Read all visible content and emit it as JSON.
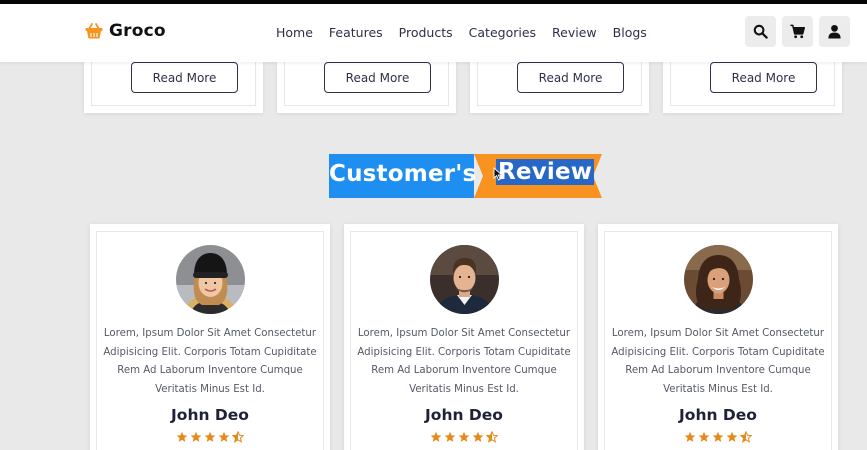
{
  "header": {
    "logo_text": "Groco",
    "logo_icon": "basket-icon",
    "nav": [
      {
        "label": "Home"
      },
      {
        "label": "Features"
      },
      {
        "label": "Products"
      },
      {
        "label": "Categories"
      },
      {
        "label": "Review"
      },
      {
        "label": "Blogs"
      }
    ],
    "actions": [
      "search-icon",
      "cart-icon",
      "user-icon"
    ]
  },
  "feature_cards": [
    {
      "button_label": "Read More"
    },
    {
      "button_label": "Read More"
    },
    {
      "button_label": "Read More"
    },
    {
      "button_label": "Read More"
    }
  ],
  "section_heading": {
    "word1": "Customer's",
    "word2": "Review"
  },
  "reviews": [
    {
      "text": "Lorem, Ipsum Dolor Sit Amet Consectetur Adipisicing Elit. Corporis Totam Cupiditate Rem Ad Laborum Inventore Cumque Veritatis Minus Est Id.",
      "name": "John Deo",
      "rating": 4.5
    },
    {
      "text": "Lorem, Ipsum Dolor Sit Amet Consectetur Adipisicing Elit. Corporis Totam Cupiditate Rem Ad Laborum Inventore Cumque Veritatis Minus Est Id.",
      "name": "John Deo",
      "rating": 4.5
    },
    {
      "text": "Lorem, Ipsum Dolor Sit Amet Consectetur Adipisicing Elit. Corporis Totam Cupiditate Rem Ad Laborum Inventore Cumque Veritatis Minus Est Id.",
      "name": "John Deo",
      "rating": 4.5
    }
  ],
  "colors": {
    "accent_orange": "#f7931e",
    "heading_blue": "#1e8ff0",
    "text_dark": "#2f3249",
    "star": "#e58b1a"
  }
}
